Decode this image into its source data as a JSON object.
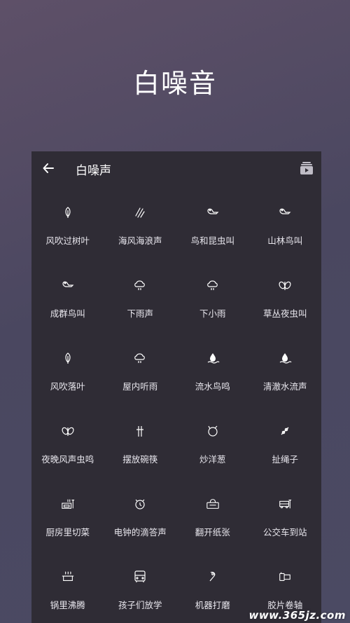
{
  "hero": {
    "title": "白噪音"
  },
  "appbar": {
    "title": "白噪声",
    "back_icon": "arrow-left-icon",
    "media_icon": "playlist-play-icon"
  },
  "sounds": [
    {
      "label": "风吹过树叶",
      "icon": "leaf"
    },
    {
      "label": "海风海浪声",
      "icon": "wind"
    },
    {
      "label": "鸟和昆虫叫",
      "icon": "bird"
    },
    {
      "label": "山林鸟叫",
      "icon": "bird"
    },
    {
      "label": "成群鸟叫",
      "icon": "bird"
    },
    {
      "label": "下雨声",
      "icon": "rain-cloud"
    },
    {
      "label": "下小雨",
      "icon": "rain-cloud"
    },
    {
      "label": "草丛夜虫叫",
      "icon": "insect"
    },
    {
      "label": "风吹落叶",
      "icon": "leaf"
    },
    {
      "label": "屋内听雨",
      "icon": "rain-cloud"
    },
    {
      "label": "流水鸟鸣",
      "icon": "water-drop"
    },
    {
      "label": "清澈水流声",
      "icon": "water-drop"
    },
    {
      "label": "夜晚风声虫鸣",
      "icon": "insect"
    },
    {
      "label": "摆放碗筷",
      "icon": "chopsticks"
    },
    {
      "label": "炒洋葱",
      "icon": "onion"
    },
    {
      "label": "扯绳子",
      "icon": "rope"
    },
    {
      "label": "厨房里切菜",
      "icon": "kitchen"
    },
    {
      "label": "电钟的滴答声",
      "icon": "alarm-clock"
    },
    {
      "label": "翻开纸张",
      "icon": "tissue-box"
    },
    {
      "label": "公交车到站",
      "icon": "bus-stop"
    },
    {
      "label": "锅里沸腾",
      "icon": "pot"
    },
    {
      "label": "孩子们放学",
      "icon": "school-bus"
    },
    {
      "label": "机器打磨",
      "icon": "machine"
    },
    {
      "label": "胶片卷轴",
      "icon": "film-roll"
    }
  ],
  "watermark": "www.365jz.com"
}
